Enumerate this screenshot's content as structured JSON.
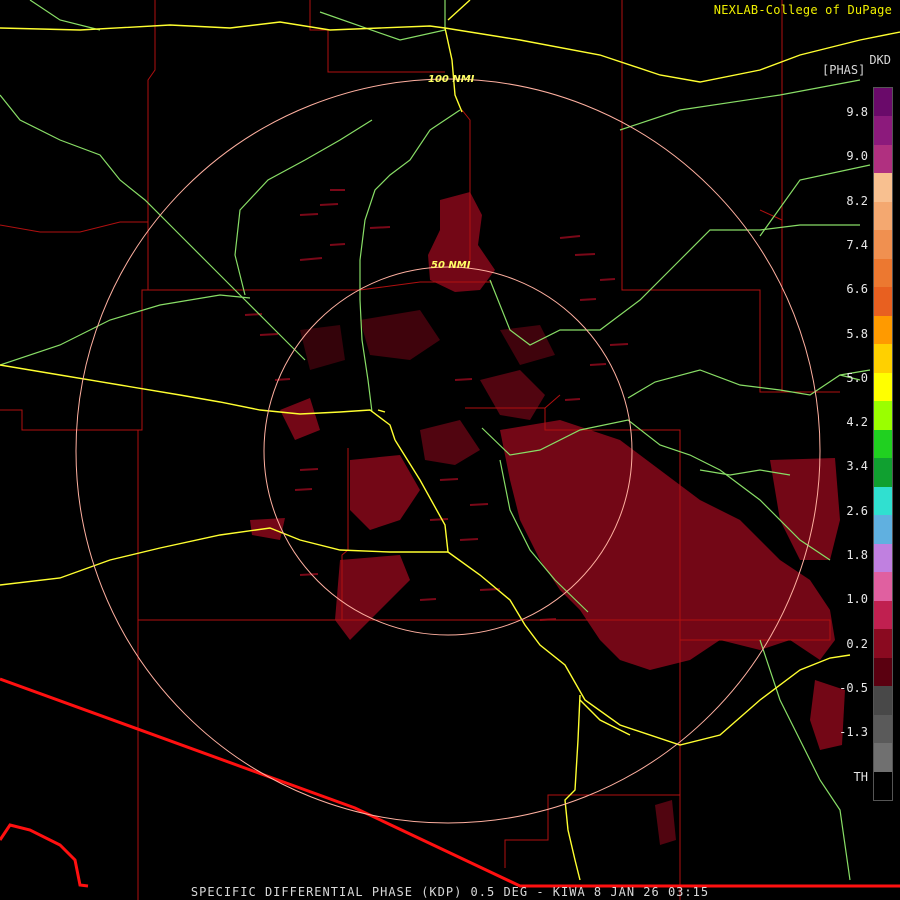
{
  "credit": "NEXLAB-College of DuPage",
  "footer": "SPECIFIC DIFFERENTIAL PHASE (KDP) 0.5 DEG - KIWA 8 JAN 26 03:15",
  "legend": {
    "product": "DKD",
    "unit": "[PHAS]",
    "ticks": [
      "9.8",
      "9.0",
      "8.2",
      "7.4",
      "6.6",
      "5.8",
      "5.0",
      "4.2",
      "3.4",
      "2.6",
      "1.8",
      "1.0",
      "0.2",
      "-0.5",
      "-1.3",
      "TH"
    ],
    "colors": [
      "#6a0a6a",
      "#8c1a7c",
      "#b03080",
      "#f8c090",
      "#f4a870",
      "#f09050",
      "#ec7830",
      "#e86020",
      "#ff9a00",
      "#ffd000",
      "#ffff00",
      "#9aff00",
      "#20d020",
      "#10a030",
      "#30e0d0",
      "#60b0e0",
      "#c080e0",
      "#e060a0",
      "#c02050",
      "#8a0a20",
      "#5a0010",
      "#484848",
      "#5a5a5a",
      "#707070",
      "#000000"
    ]
  },
  "rings": {
    "inner_label": "50 NMI",
    "outer_label": "100 NMI"
  },
  "colors": {
    "state_border": "#ff1010",
    "county_line": "#b01010",
    "highway": "#ffff30",
    "road": "#88dd66",
    "range_ring": "#ffb0a0",
    "kdp_echo": "#7a0818"
  }
}
